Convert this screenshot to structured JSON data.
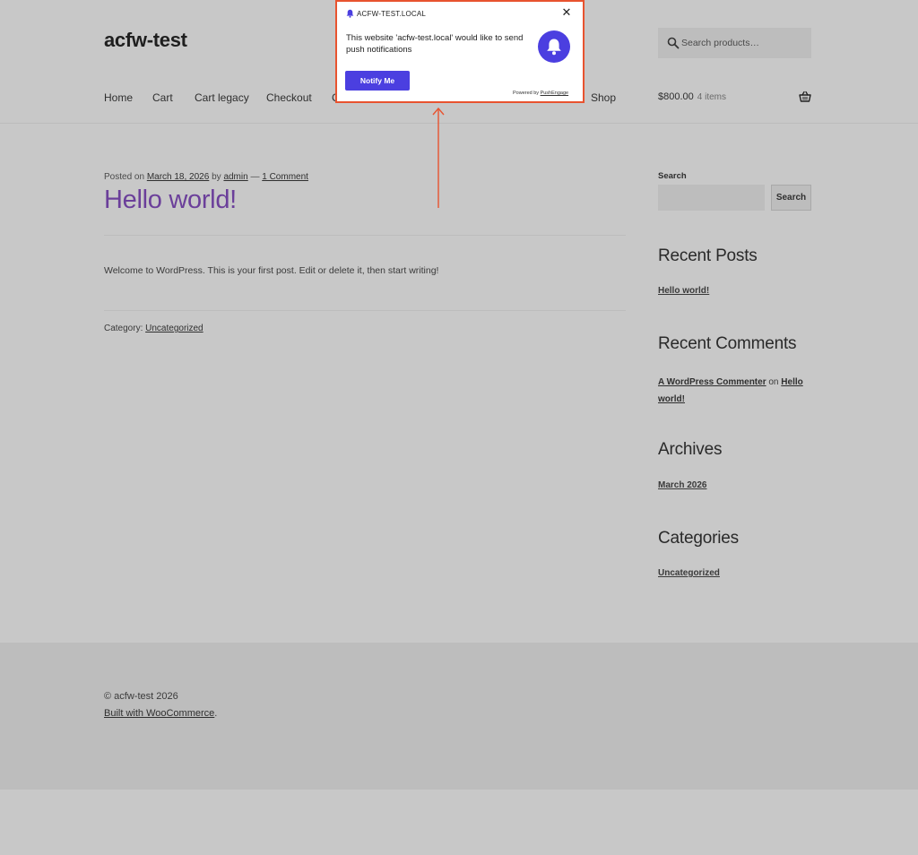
{
  "header": {
    "site_title": "acfw-test",
    "search_placeholder": "Search products…",
    "nav": [
      "Home",
      "Cart",
      "Cart legacy",
      "Checkout",
      "C",
      "Shop"
    ],
    "cart_total": "$800.00",
    "cart_count": "4 items"
  },
  "post": {
    "meta_prefix": "Posted on ",
    "date": "March 18, 2026",
    "by": " by ",
    "author": "admin",
    "dash": " — ",
    "comments": "1 Comment",
    "title": "Hello world!",
    "body": "Welcome to WordPress. This is your first post. Edit or delete it, then start writing!",
    "category_label": "Category: ",
    "category": "Uncategorized"
  },
  "sidebar": {
    "search_label": "Search",
    "search_button": "Search",
    "recent_posts_title": "Recent Posts",
    "recent_post": "Hello world!",
    "recent_comments_title": "Recent Comments",
    "commenter": "A WordPress Commenter",
    "on": " on ",
    "comment_post": "Hello world!",
    "archives_title": "Archives",
    "archive": "March 2026",
    "categories_title": "Categories",
    "category": "Uncategorized"
  },
  "footer": {
    "copyright": "© acfw-test 2026",
    "built_with": "Built with WooCommerce",
    "period": "."
  },
  "popup": {
    "domain": "ACFW-TEST.LOCAL",
    "message": "This website 'acfw-test.local' would like to send push notifications",
    "button": "Notify Me",
    "powered_prefix": "Powered by ",
    "powered_brand": "PushEngage",
    "accent": "#4b3fe0",
    "highlight": "#e8532f"
  }
}
